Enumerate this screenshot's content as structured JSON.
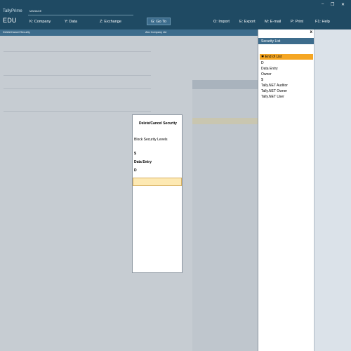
{
  "header": {
    "product": "TallyPrime",
    "edition": "EDU",
    "manage_label": "MANAGE",
    "menu": [
      {
        "key": "K",
        "label": "K: Company"
      },
      {
        "key": "Y",
        "label": "Y: Data"
      },
      {
        "key": "Z",
        "label": "Z: Exchange"
      },
      {
        "key": "G",
        "label": "G: Go To"
      },
      {
        "key": "O",
        "label": "O: Import"
      },
      {
        "key": "E",
        "label": "E: Export"
      },
      {
        "key": "M",
        "label": "M: E-mail"
      },
      {
        "key": "P",
        "label": "P: Print"
      },
      {
        "key": "F1",
        "label": "F1: Help"
      }
    ],
    "window_controls": {
      "minimize": "–",
      "maximize": "❐",
      "close": "✕"
    }
  },
  "subbar": {
    "left_title": "Delete/Cancel Security",
    "center_title": "Abc Company Ltd"
  },
  "dialog": {
    "title": "Delete/Cancel Security",
    "subtitle": "Block Security Levels",
    "entries": [
      "$",
      "Data Entry",
      "D"
    ],
    "input_value": ""
  },
  "security_list": {
    "title": "Security List",
    "close": "x",
    "items": [
      {
        "label": "End of List",
        "selected": true,
        "icon": "star-icon"
      },
      {
        "label": "D",
        "selected": false
      },
      {
        "label": "Data Entry",
        "selected": false
      },
      {
        "label": "Owner",
        "selected": false
      },
      {
        "label": "$",
        "selected": false
      },
      {
        "label": "Tally.NET Auditor",
        "selected": false
      },
      {
        "label": "Tally.NET Owner",
        "selected": false
      },
      {
        "label": "Tally.NET User",
        "selected": false
      }
    ]
  },
  "colors": {
    "header_bg": "#1f4a63",
    "subbar_bg": "#3d6c8c",
    "selection": "#f5a623",
    "input_bg": "#fde9b3",
    "backdrop": "#c6ccd2"
  }
}
